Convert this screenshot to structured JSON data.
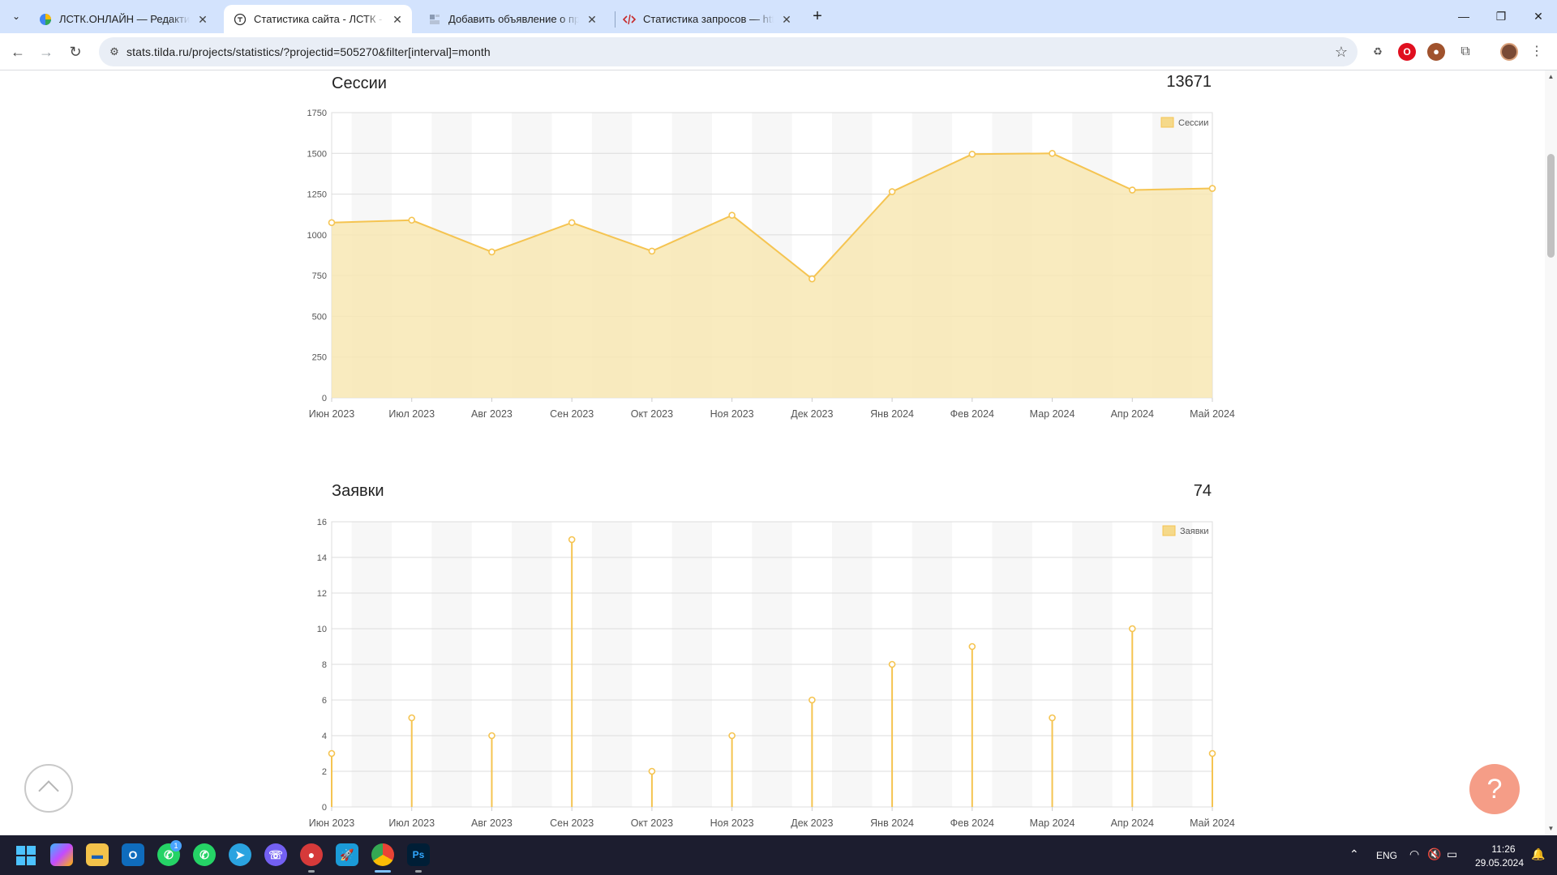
{
  "browser": {
    "tabs": [
      {
        "title": "ЛСТК.ОНЛАЙН — Редактирование",
        "favicon": "color-circle-icon",
        "active": false
      },
      {
        "title": "Статистика сайта - ЛСТК - Tilda",
        "favicon": "tilda-icon",
        "active": true
      },
      {
        "title": "Добавить объявление о продаже",
        "favicon": "doc-icon",
        "active": false
      },
      {
        "title": "Статистика запросов — https://",
        "favicon": "code-icon",
        "active": false
      }
    ],
    "url": "stats.tilda.ru/projects/statistics/?projectid=505270&filter[interval]=month"
  },
  "colors": {
    "accent": "#f5c451",
    "area_fill": "#f8e8b4",
    "help": "#f59d87"
  },
  "sessions": {
    "title": "Сессии",
    "total": "13671",
    "legend": "Сессии"
  },
  "requests": {
    "title": "Заявки",
    "total": "74",
    "legend": "Заявки"
  },
  "chart_data": [
    {
      "type": "area",
      "title": "Сессии",
      "categories": [
        "Июн 2023",
        "Июл 2023",
        "Авг 2023",
        "Сен 2023",
        "Окт 2023",
        "Ноя 2023",
        "Дек 2023",
        "Янв 2024",
        "Фев 2024",
        "Мар 2024",
        "Апр 2024",
        "Май 2024"
      ],
      "series": [
        {
          "name": "Сессии",
          "values": [
            1075,
            1090,
            895,
            1075,
            900,
            1120,
            730,
            1265,
            1495,
            1500,
            1275,
            1285
          ]
        }
      ],
      "ylim": [
        0,
        1750
      ],
      "yticks": [
        0,
        250,
        500,
        750,
        1000,
        1250,
        1500,
        1750
      ],
      "legend": "top-right",
      "grid": true
    },
    {
      "type": "bar",
      "title": "Заявки",
      "categories": [
        "Июн 2023",
        "Июл 2023",
        "Авг 2023",
        "Сен 2023",
        "Окт 2023",
        "Ноя 2023",
        "Дек 2023",
        "Янв 2024",
        "Фев 2024",
        "Мар 2024",
        "Апр 2024",
        "Май 2024"
      ],
      "series": [
        {
          "name": "Заявки",
          "values": [
            3,
            5,
            4,
            15,
            2,
            4,
            6,
            8,
            9,
            5,
            10,
            3
          ]
        }
      ],
      "ylim": [
        0,
        16
      ],
      "yticks": [
        0,
        2,
        4,
        6,
        8,
        10,
        12,
        14,
        16
      ],
      "legend": "top-right",
      "grid": true
    }
  ],
  "taskbar": {
    "lang": "ENG",
    "time": "11:26",
    "date": "29.05.2024",
    "whatsapp_badge": "1"
  }
}
